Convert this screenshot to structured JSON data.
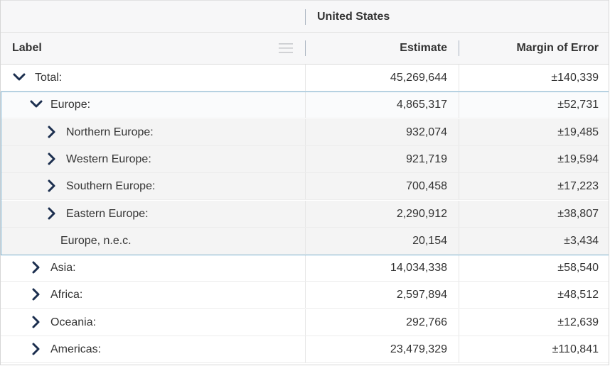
{
  "header": {
    "group_title": "United States",
    "col_label": "Label",
    "col_estimate": "Estimate",
    "col_moe": "Margin of Error"
  },
  "rows": [
    {
      "label": "Total:",
      "estimate": "45,269,644",
      "moe": "±140,339",
      "icon": "chevron-down-icon",
      "level": 0,
      "expanded": true
    },
    {
      "label": "Europe:",
      "estimate": "4,865,317",
      "moe": "±52,731",
      "icon": "chevron-down-icon",
      "level": 1,
      "expanded": true
    },
    {
      "label": "Northern Europe:",
      "estimate": "932,074",
      "moe": "±19,485",
      "icon": "chevron-right-icon",
      "level": 2,
      "expanded": false
    },
    {
      "label": "Western Europe:",
      "estimate": "921,719",
      "moe": "±19,594",
      "icon": "chevron-right-icon",
      "level": 2,
      "expanded": false
    },
    {
      "label": "Southern Europe:",
      "estimate": "700,458",
      "moe": "±17,223",
      "icon": "chevron-right-icon",
      "level": 2,
      "expanded": false
    },
    {
      "label": "Eastern Europe:",
      "estimate": "2,290,912",
      "moe": "±38,807",
      "icon": "chevron-right-icon",
      "level": 2,
      "expanded": false
    },
    {
      "label": "Europe, n.e.c.",
      "estimate": "20,154",
      "moe": "±3,434",
      "icon": "",
      "level": 2,
      "expanded": false
    },
    {
      "label": "Asia:",
      "estimate": "14,034,338",
      "moe": "±58,540",
      "icon": "chevron-right-icon",
      "level": 1,
      "expanded": false
    },
    {
      "label": "Africa:",
      "estimate": "2,597,894",
      "moe": "±48,512",
      "icon": "chevron-right-icon",
      "level": 1,
      "expanded": false
    },
    {
      "label": "Oceania:",
      "estimate": "292,766",
      "moe": "±12,639",
      "icon": "chevron-right-icon",
      "level": 1,
      "expanded": false
    },
    {
      "label": "Americas:",
      "estimate": "23,479,329",
      "moe": "±110,841",
      "icon": "chevron-right-icon",
      "level": 1,
      "expanded": false
    }
  ],
  "colors": {
    "chevron": "#1c2f4f",
    "selection_border": "#7fb6d6",
    "header_bg": "#f7f7f8"
  }
}
